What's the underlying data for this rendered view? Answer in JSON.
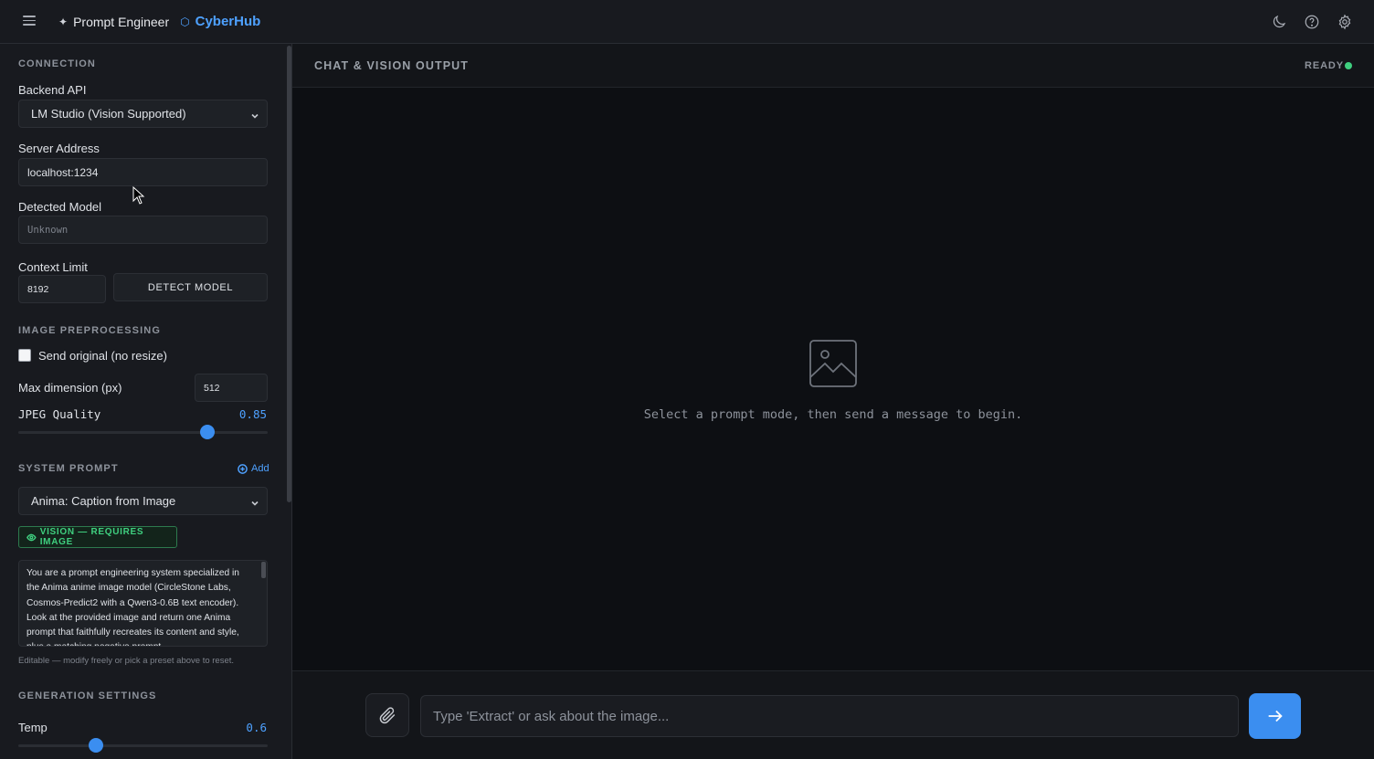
{
  "header": {
    "app_name": "Prompt Engineer",
    "brand": "CyberHub",
    "icons": [
      "menu-icon",
      "moon-icon",
      "help-icon",
      "settings-icon"
    ]
  },
  "sidebar": {
    "connection": {
      "title": "CONNECTION",
      "backend_label": "Backend API",
      "backend_value": "LM Studio (Vision Supported)",
      "server_label": "Server Address",
      "server_value": "localhost:1234",
      "model_label": "Detected Model",
      "model_value": "Unknown",
      "context_label": "Context Limit",
      "context_value": "8192",
      "detect_button": "DETECT MODEL"
    },
    "image": {
      "title": "IMAGE PREPROCESSING",
      "send_original_label": "Send original (no resize)",
      "send_original_checked": false,
      "max_dim_label": "Max dimension (px)",
      "max_dim_value": "512",
      "jpeg_label": "JPEG Quality",
      "jpeg_value": "0.85",
      "jpeg_fraction": 0.76
    },
    "system_prompt": {
      "title": "SYSTEM PROMPT",
      "add_label": "Add",
      "preset": "Anima: Caption from Image",
      "badge": "VISION — REQUIRES IMAGE",
      "text": "You are a prompt engineering system specialized in the Anima anime image model (CircleStone Labs, Cosmos-Predict2 with a Qwen3-0.6B text encoder). Look at the provided image and return one Anima prompt that faithfully recreates its content and style, plus a matching negative prompt.",
      "hint": "Editable — modify freely or pick a preset above to reset."
    },
    "generation": {
      "title": "GENERATION SETTINGS",
      "temp_label": "Temp",
      "temp_value": "0.6",
      "temp_fraction": 0.31
    }
  },
  "main": {
    "title": "CHAT & VISION OUTPUT",
    "status": "READY",
    "status_color": "#3fcf7f",
    "empty_icon": "image-icon",
    "empty_text": "Select a prompt mode, then send a message to begin.",
    "input_placeholder": "Type 'Extract' or ask about the image..."
  },
  "colors": {
    "accent": "#3b8ef0",
    "brand": "#4ea1ff",
    "vision_badge": "#3fcf7f"
  }
}
